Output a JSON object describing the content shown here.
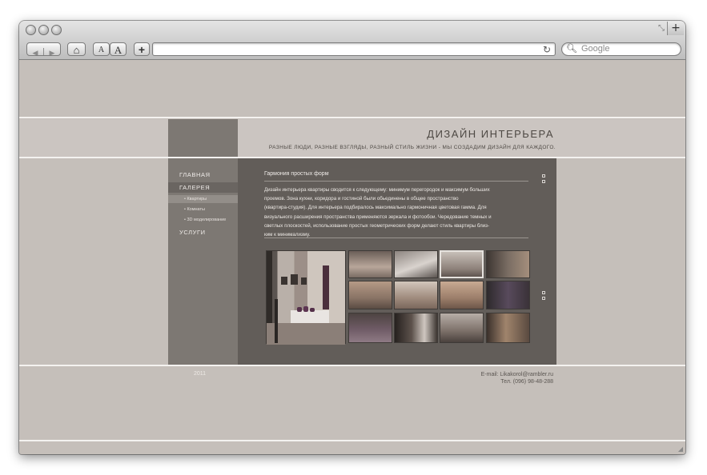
{
  "browser": {
    "newtab_label": "+",
    "text_smaller_label": "A",
    "text_larger_label": "A",
    "add_bookmark_label": "+",
    "url_value": "",
    "reload_glyph": "↻",
    "search_icon_glyph": "🔍︎",
    "search_placeholder": "Google",
    "back_glyph": "◀",
    "forward_glyph": "▶",
    "home_glyph": "⌂",
    "resize_glyph": "⤡"
  },
  "site": {
    "title": "ДИЗАЙН ИНТЕРЬЕРА",
    "subtitle": "РАЗНЫЕ ЛЮДИ, РАЗНЫЕ  ВЗГЛЯДЫ, РАЗНЫЙ СТИЛЬ ЖИЗНИ - МЫ СОЗДАДИМ ДИЗАЙН ДЛЯ КАЖДОГО.",
    "menu": [
      {
        "label": "ГЛАВНАЯ",
        "active": false
      },
      {
        "label": "ГАЛЕРЕЯ",
        "active": true
      },
      {
        "label": "УСЛУГИ",
        "active": false
      }
    ],
    "submenu": [
      {
        "label": "• Квартиры",
        "active": true
      },
      {
        "label": "• Комнаты",
        "active": false
      },
      {
        "label": "• 3D моделирование",
        "active": false
      }
    ],
    "article": {
      "title": "Гармония простых форм",
      "lines": [
        "Дизайн интерьера квартиры сводится к следующему: минимум перегородок и максимум больших",
        "проемов. Зона кухни, коридора и гостиной были обьединены в  общее пространство",
        "(квартира-студия).  Для интерьера подбиралось максимально гармоничная цветовая гамма.  Для",
        "визуального расширения пространства применяются зеркала и фотообои. Чередование темных и",
        "светлых плоскостей, использование простых геометрических форм делают стиль квартиры близ-",
        "ким к минимализму."
      ]
    },
    "footer": {
      "year": "2011",
      "email": "E-mail: Likakorol@rambler.ru",
      "phone": "Тел. (096) 98-48-288"
    }
  },
  "colors": {
    "page_bg": "#c5bfba",
    "sidebar": "#7d7873",
    "content_bg": "#625d59",
    "title_text": "#4e4944"
  }
}
